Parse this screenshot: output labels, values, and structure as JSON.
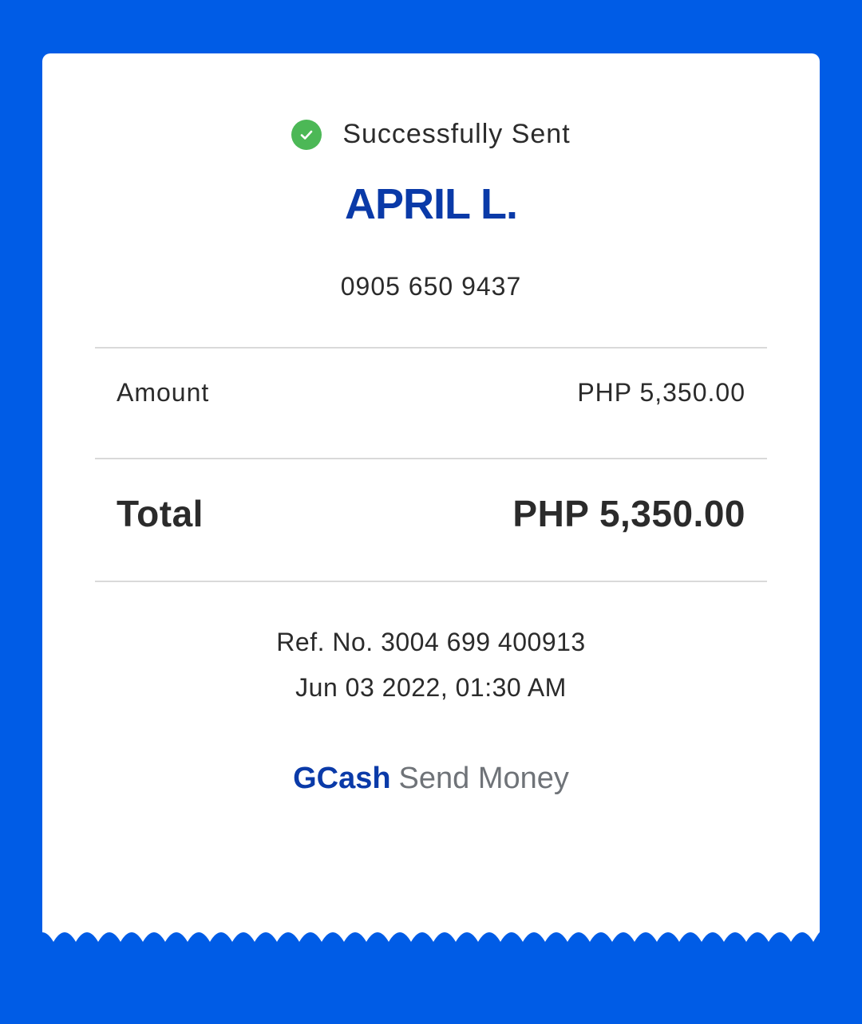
{
  "status": {
    "text": "Successfully Sent",
    "icon": "check-circle-icon",
    "icon_color": "#4cb856"
  },
  "recipient": {
    "name": "APRIL L.",
    "number": "0905 650 9437"
  },
  "amount": {
    "label": "Amount",
    "value": "PHP 5,350.00"
  },
  "total": {
    "label": "Total",
    "value": "PHP 5,350.00"
  },
  "reference": {
    "ref_no": "Ref. No. 3004 699 400913",
    "datetime": "Jun 03 2022, 01:30 AM"
  },
  "brand": {
    "name": "GCash",
    "service": "Send Money"
  },
  "colors": {
    "background": "#005ce6",
    "brand_blue": "#0a3aa8",
    "service_gray": "#6f7378"
  }
}
